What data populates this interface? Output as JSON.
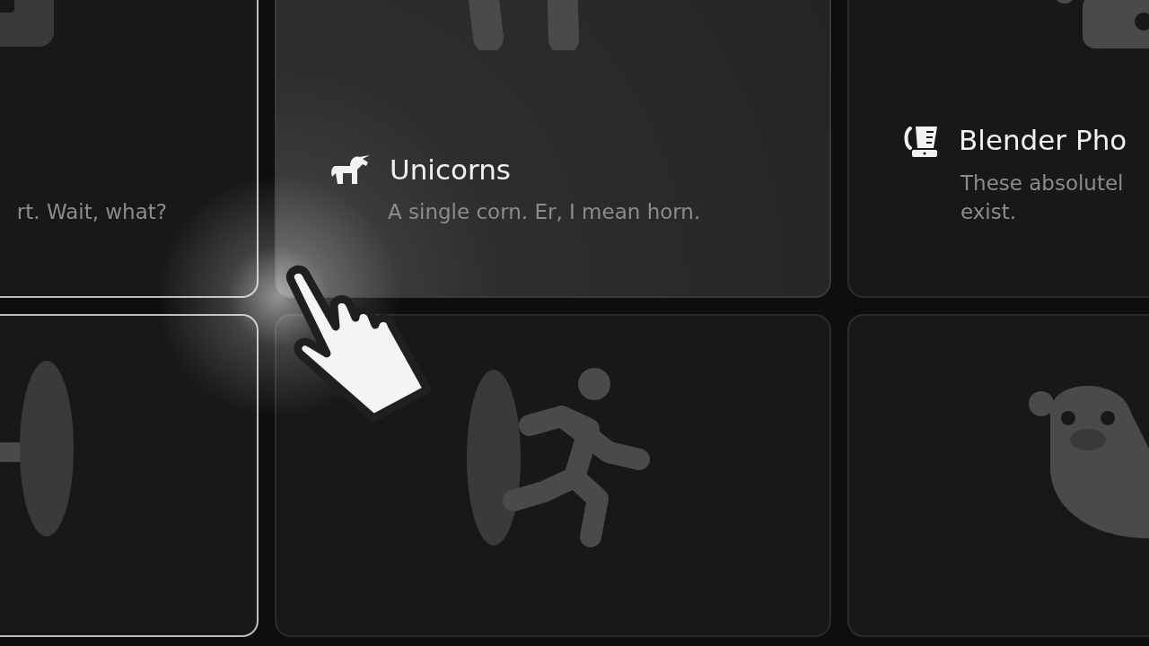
{
  "rows": [
    [
      {
        "description": "rt. Wait, what?",
        "hovered": false
      },
      {
        "title": "Unicorns",
        "description": "A single corn. Er, I mean horn.",
        "hovered": true
      },
      {
        "title": "Blender Pho",
        "description": "These absolutel\nexist.",
        "hovered": false
      }
    ],
    [
      {
        "hovered": false
      },
      {
        "hovered": false
      },
      {
        "hovered": false
      }
    ]
  ]
}
